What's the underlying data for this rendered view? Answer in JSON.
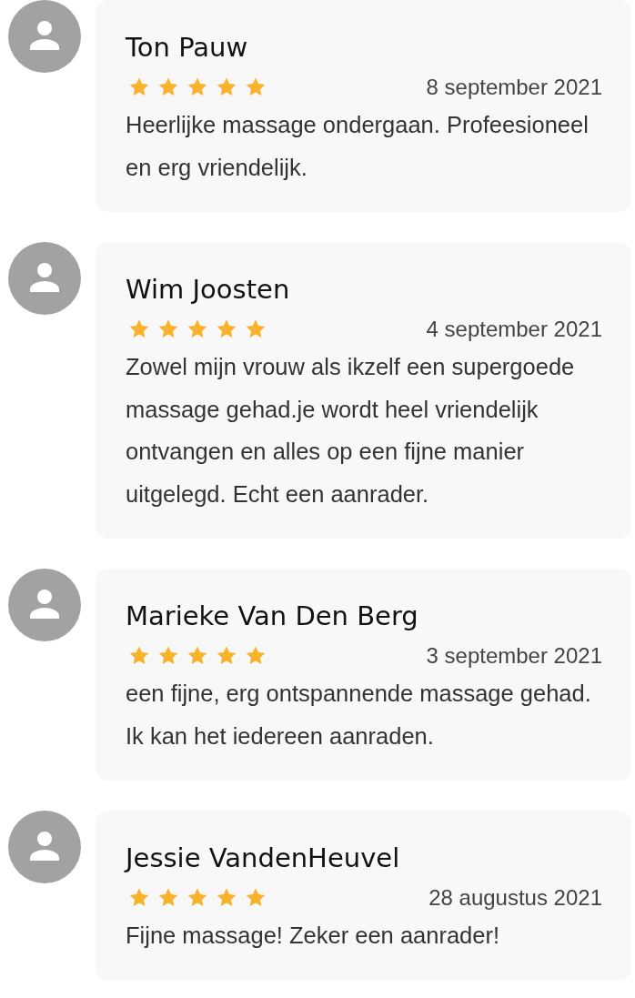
{
  "reviews": [
    {
      "name": "Ton Pauw",
      "stars": 5,
      "date": "8 september 2021",
      "text": "Heerlijke massage ondergaan. Profeesioneel en erg vriendelijk."
    },
    {
      "name": "Wim Joosten",
      "stars": 5,
      "date": "4 september 2021",
      "text": "Zowel mijn vrouw als ikzelf een supergoede massage gehad.je wordt heel vriendelijk ontvangen en alles op een fijne manier uitgelegd. Echt een aanrader."
    },
    {
      "name": "Marieke Van Den Berg",
      "stars": 5,
      "date": "3 september 2021",
      "text": "een fijne, erg ontspannende massage gehad. Ik kan het iedereen aanraden."
    },
    {
      "name": "Jessie VandenHeuvel",
      "stars": 5,
      "date": "28 augustus 2021",
      "text": "Fijne massage! Zeker een aanrader!"
    }
  ]
}
